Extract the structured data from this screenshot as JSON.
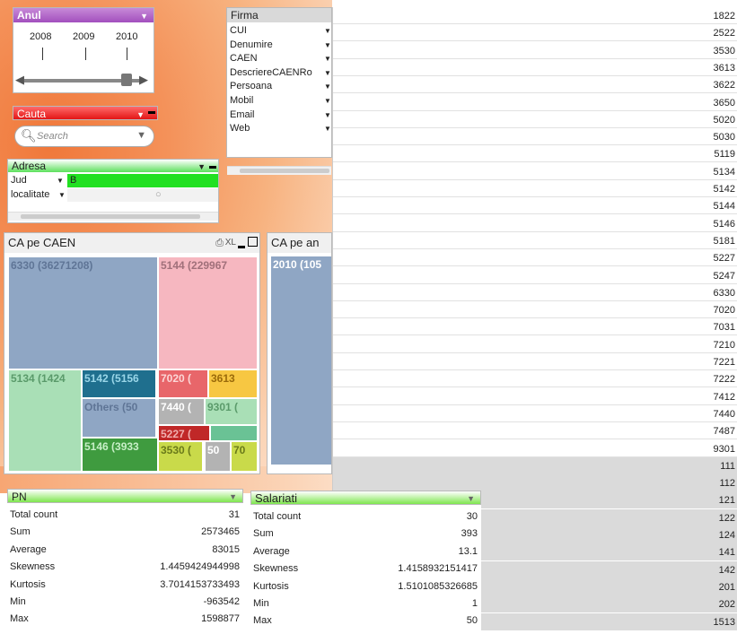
{
  "anul": {
    "title": "Anul",
    "years": [
      "2008",
      "2009",
      "2010"
    ]
  },
  "cauta": {
    "title": "Cauta",
    "placeholder": "Search"
  },
  "adresa": {
    "title": "Adresa",
    "fields": [
      {
        "label": "Jud",
        "value": "B"
      },
      {
        "label": "localitate",
        "value": ""
      }
    ]
  },
  "firma": {
    "title": "Firma",
    "fields": [
      "CUI",
      "Denumire",
      "CAEN",
      "DescriereCAENRo",
      "Persoana",
      "Mobil",
      "Email",
      "Web"
    ]
  },
  "codes_white": [
    "1822",
    "2522",
    "3530",
    "3613",
    "3622",
    "3650",
    "5020",
    "5030",
    "5119",
    "5134",
    "5142",
    "5144",
    "5146",
    "5181",
    "5227",
    "5247",
    "6330",
    "7020",
    "7031",
    "7210",
    "7221",
    "7222",
    "7412",
    "7440",
    "7487",
    "9301"
  ],
  "codes_grey": [
    "111",
    "112",
    "121",
    "122",
    "124",
    "141",
    "142",
    "201",
    "202",
    "1513"
  ],
  "caen": {
    "title": "CA pe CAEN",
    "tools": "XL",
    "cells": [
      {
        "label": "6330 (36271208)",
        "color": "#8fa6c4"
      },
      {
        "label": "5144 (229967",
        "color": "#f6b7c0"
      },
      {
        "label": "5134 (1424",
        "color": "#a9dfb6"
      },
      {
        "label": "5142 (5156",
        "color": "#1f6f8e"
      },
      {
        "label": "Others (50",
        "color": "#8fa6c4"
      },
      {
        "label": "7020 (",
        "color": "#e8666a"
      },
      {
        "label": "3613",
        "color": "#f7c742"
      },
      {
        "label": "7440 (",
        "color": "#b3b3b3"
      },
      {
        "label": "9301 (",
        "color": "#a9dfb6"
      },
      {
        "label": "5227 (",
        "color": "#c02828"
      },
      {
        "label": "",
        "color": "#6ac295"
      },
      {
        "label": "5146 (3933",
        "color": "#3f9b3f"
      },
      {
        "label": "3530 (",
        "color": "#c9da4a"
      },
      {
        "label": "50",
        "color": "#b3b3b3"
      },
      {
        "label": "70",
        "color": "#c9da4a"
      }
    ]
  },
  "caan": {
    "title": "CA pe an",
    "cell": "2010 (105"
  },
  "pn": {
    "title": "PN",
    "rows": [
      {
        "k": "Total count",
        "v": "31"
      },
      {
        "k": "Sum",
        "v": "2573465"
      },
      {
        "k": "Average",
        "v": "83015"
      },
      {
        "k": "Skewness",
        "v": "1.4459424944998"
      },
      {
        "k": "Kurtosis",
        "v": "3.7014153733493"
      },
      {
        "k": "Min",
        "v": "-963542"
      },
      {
        "k": "Max",
        "v": "1598877"
      }
    ]
  },
  "salariati": {
    "title": "Salariati",
    "rows": [
      {
        "k": "Total count",
        "v": "30"
      },
      {
        "k": "Sum",
        "v": "393"
      },
      {
        "k": "Average",
        "v": "13.1"
      },
      {
        "k": "Skewness",
        "v": "1.4158932151417"
      },
      {
        "k": "Kurtosis",
        "v": "1.5101085326685"
      },
      {
        "k": "Min",
        "v": "1"
      },
      {
        "k": "Max",
        "v": "50"
      }
    ]
  }
}
